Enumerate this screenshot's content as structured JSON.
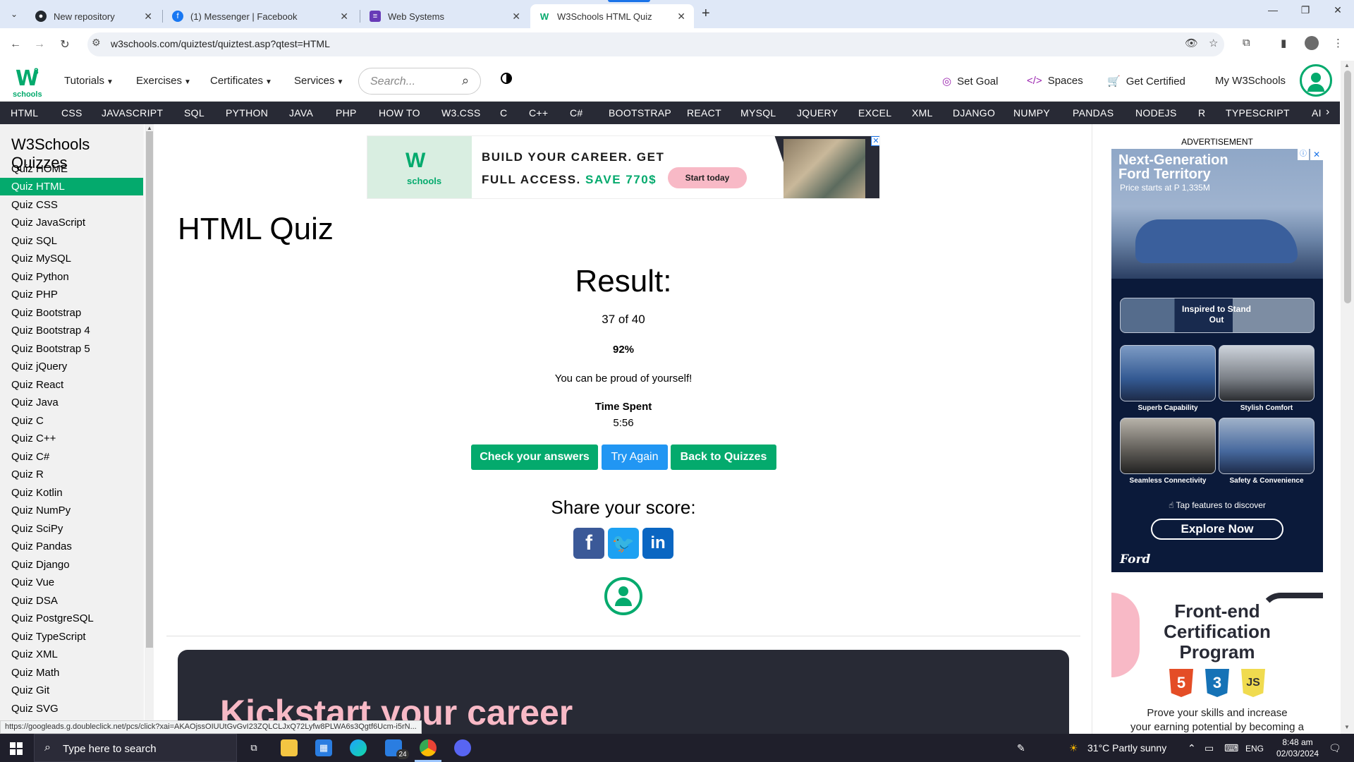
{
  "browser": {
    "tabs": [
      {
        "label": "New repository",
        "icon": "github-icon"
      },
      {
        "label": "(1) Messenger | Facebook",
        "icon": "facebook-icon"
      },
      {
        "label": "Web Systems",
        "icon": "form-icon"
      },
      {
        "label": "W3Schools HTML Quiz",
        "icon": "w3schools-icon",
        "active": true
      }
    ],
    "url": "w3schools.com/quiztest/quiztest.asp?qtest=HTML",
    "status_url": "https://googleads.g.doubleclick.net/pcs/click?xai=AKAOjssOIUUtGvGvI23ZQLCLJxQ72Lyfw8PLWA6s3Qgtf6Ucm-i5rN..."
  },
  "w3nav": {
    "logo_w": "W",
    "logo_sup": "3",
    "logo_text": "schools",
    "menu": [
      "Tutorials",
      "Exercises",
      "Certificates",
      "Services"
    ],
    "search_placeholder": "Search...",
    "right": [
      "Set Goal",
      "Spaces",
      "Get Certified",
      "My W3Schools"
    ]
  },
  "subnav": [
    "HTML",
    "CSS",
    "JAVASCRIPT",
    "SQL",
    "PYTHON",
    "JAVA",
    "PHP",
    "HOW TO",
    "W3.CSS",
    "C",
    "C++",
    "C#",
    "BOOTSTRAP",
    "REACT",
    "MYSQL",
    "JQUERY",
    "EXCEL",
    "XML",
    "DJANGO",
    "NUMPY",
    "PANDAS",
    "NODEJS",
    "R",
    "TYPESCRIPT",
    "AI"
  ],
  "sidebar": {
    "title": "W3Schools Quizzes",
    "items": [
      "Quiz HOME",
      "Quiz HTML",
      "Quiz CSS",
      "Quiz JavaScript",
      "Quiz SQL",
      "Quiz MySQL",
      "Quiz Python",
      "Quiz PHP",
      "Quiz Bootstrap",
      "Quiz Bootstrap 4",
      "Quiz Bootstrap 5",
      "Quiz jQuery",
      "Quiz React",
      "Quiz Java",
      "Quiz C",
      "Quiz C++",
      "Quiz C#",
      "Quiz R",
      "Quiz Kotlin",
      "Quiz NumPy",
      "Quiz SciPy",
      "Quiz Pandas",
      "Quiz Django",
      "Quiz Vue",
      "Quiz DSA",
      "Quiz PostgreSQL",
      "Quiz TypeScript",
      "Quiz XML",
      "Quiz Math",
      "Quiz Git",
      "Quiz SVG"
    ],
    "active_index": 1
  },
  "banner_ad": {
    "logo_w": "W",
    "logo_text": "schools",
    "line1": "BUILD YOUR CAREER. GET",
    "line2_a": "FULL ACCESS.",
    "line2_b": "SAVE 770$",
    "cta": "Start today"
  },
  "main": {
    "title": "HTML Quiz",
    "result_heading": "Result:",
    "score": "37 of 40",
    "percent": "92%",
    "message": "You can be proud of yourself!",
    "time_label": "Time Spent",
    "time_value": "5:56",
    "buttons": {
      "check": "Check your answers",
      "retry": "Try Again",
      "back": "Back to Quizzes"
    },
    "share_heading": "Share your score:",
    "career_heading": "Kickstart your career"
  },
  "right_ads": {
    "label": "ADVERTISEMENT",
    "ford": {
      "title1": "Next-Generation",
      "title2": "Ford Territory",
      "price": "Price starts at P 1,335M",
      "strip": "Inspired to Stand Out",
      "tiles": [
        "Superb Capability",
        "Stylish Comfort",
        "Seamless Connectivity",
        "Safety & Convenience"
      ],
      "tap": "Tap features to discover",
      "cta": "Explore Now",
      "logo": "Ford"
    },
    "cert": {
      "line1": "Front-end",
      "line2": "Certification",
      "line3": "Program",
      "badges": [
        "5",
        "3",
        "JS"
      ],
      "p1": "Prove your skills and increase",
      "p2": "your earning potential by becoming a"
    }
  },
  "taskbar": {
    "search_placeholder": "Type here to search",
    "mail_badge": "24",
    "weather": "31°C  Partly sunny",
    "lang": "ENG",
    "time": "8:48 am",
    "date": "02/03/2024"
  },
  "colors": {
    "brand_green": "#04aa6d",
    "retry_blue": "#2196f3",
    "dark": "#282a35",
    "pink": "#f8b9c6"
  }
}
